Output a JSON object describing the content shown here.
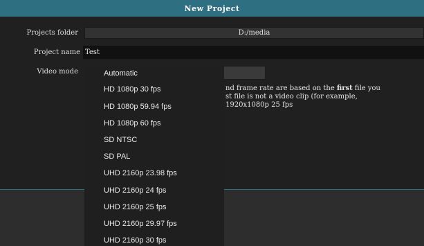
{
  "dialog": {
    "title": "New Project",
    "projects_folder_label": "Projects folder",
    "projects_folder_value": "D:/media",
    "project_name_label": "Project name",
    "project_name_value": "Test",
    "video_mode_label": "Video mode",
    "description_line1_a": "nd frame rate are based on the ",
    "description_line1_b": "first",
    "description_line1_c": " file you",
    "description_line2": "st file is not a video clip (for example,",
    "description_line3": "1920x1080p 25 fps"
  },
  "video_mode_options": [
    "Automatic",
    "HD 1080p 30 fps",
    "HD 1080p 59.94 fps",
    "HD 1080p 60 fps",
    "SD NTSC",
    "SD PAL",
    "UHD 2160p 23.98 fps",
    "UHD 2160p 24 fps",
    "UHD 2160p 25 fps",
    "UHD 2160p 29.97 fps",
    "UHD 2160p 30 fps"
  ],
  "colors": {
    "title_bar": "#2e6f82",
    "dialog_bg": "#202020",
    "dropdown_bg": "#1f1f1f"
  }
}
